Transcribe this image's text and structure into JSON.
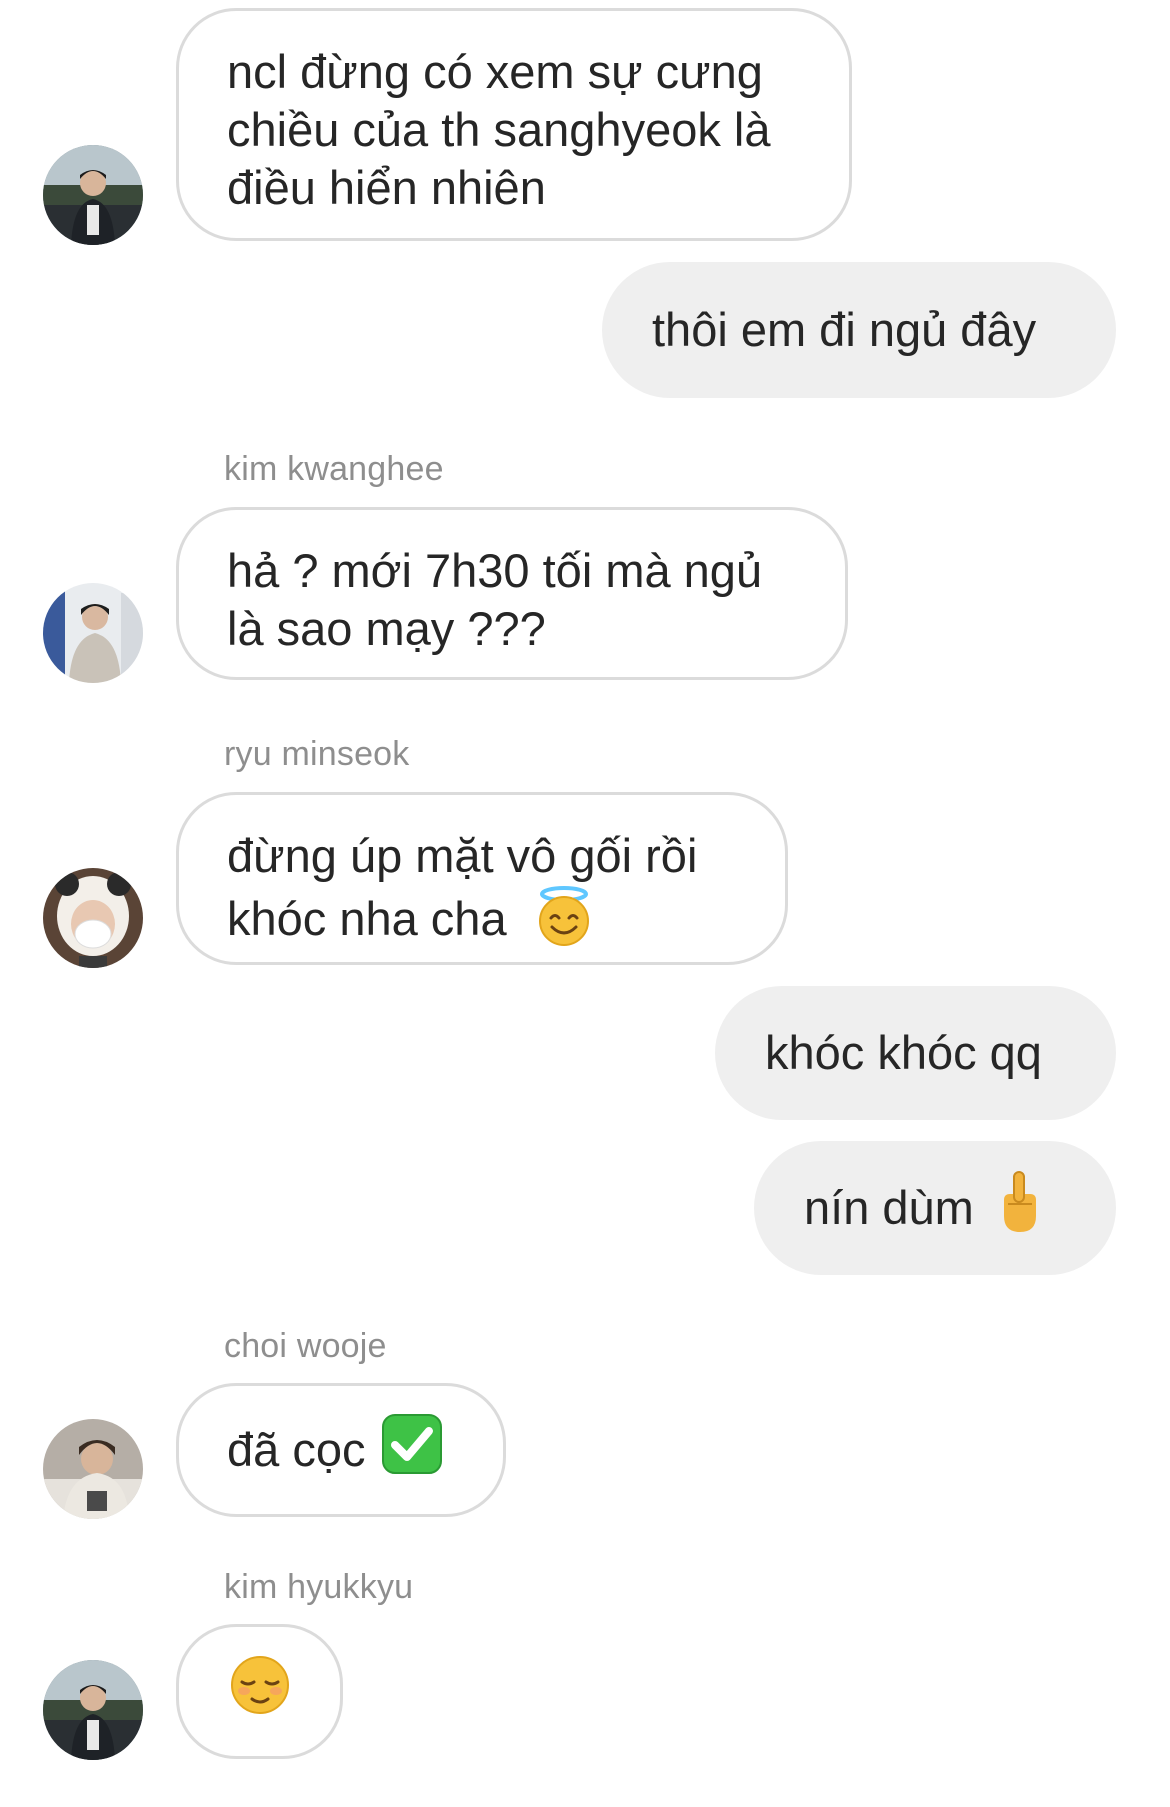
{
  "messages": [
    {
      "text": "ncl đừng có xem sự cưng chiều của th sanghyeok là điều hiển nhiên"
    },
    {
      "text": "thôi em đi ngủ đây"
    },
    {
      "sender": "kim kwanghee",
      "text": "hả ? mới 7h30 tối mà ngủ là sao mạy ???"
    },
    {
      "sender": "ryu minseok",
      "text": "đừng úp mặt vô gối rồi khóc nha cha",
      "emoji": "smiling-face-with-halo-icon"
    },
    {
      "text": "khóc khóc qq"
    },
    {
      "text": "nín dùm",
      "emoji": "middle-finger-icon"
    },
    {
      "sender": "choi wooje",
      "text": "đã cọc",
      "emoji": "check-mark-button-icon"
    },
    {
      "sender": "kim hyukkyu",
      "emoji": "relieved-face-icon"
    }
  ],
  "colors": {
    "incoming_bubble_bg": "#ffffff",
    "incoming_bubble_border": "#dbdbdb",
    "outgoing_bubble_bg": "#efefef",
    "sender_name": "#8e8e8e",
    "text": "#262626"
  }
}
